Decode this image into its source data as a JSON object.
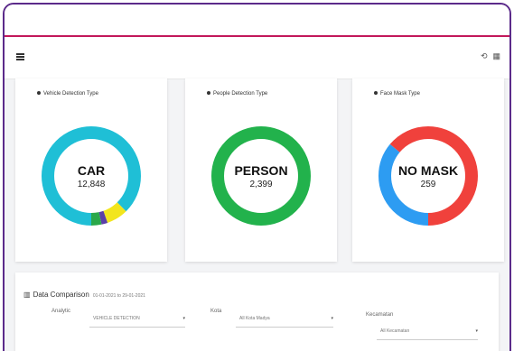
{
  "navbar": {
    "menu_icon": "hamburger-icon",
    "right_icons": [
      "refresh-icon",
      "calendar-icon"
    ]
  },
  "cards": [
    {
      "title": "Vehicle Detection Type",
      "center_label": "CAR",
      "center_value": "12,848",
      "segments": [
        {
          "label": "CAR",
          "fraction": 0.875,
          "color": "#1fbfd6"
        },
        {
          "label": "",
          "fraction": 0.07,
          "color": "#f2e51d"
        },
        {
          "label": "",
          "fraction": 0.02,
          "color": "#5b3fa8"
        },
        {
          "label": "",
          "fraction": 0.035,
          "color": "#2aa84a"
        }
      ]
    },
    {
      "title": "People Detection Type",
      "center_label": "PERSON",
      "center_value": "2,399",
      "segments": [
        {
          "label": "PERSON",
          "fraction": 1.0,
          "color": "#22b24c"
        }
      ]
    },
    {
      "title": "Face Mask Type",
      "center_label": "NO MASK",
      "center_value": "259",
      "segments": [
        {
          "label": "MASK",
          "fraction": 0.36,
          "color": "#2d9cf2"
        },
        {
          "label": "NO MASK",
          "fraction": 0.64,
          "color": "#f0413c"
        }
      ]
    }
  ],
  "comparison": {
    "icon": "bar-chart-icon",
    "title": "Data Comparison",
    "range": "01-01-2021 to 29-01-2021",
    "fields": [
      {
        "label": "Analytic",
        "value": "VEHICLE DETECTION"
      },
      {
        "label": "Kota",
        "value": "All Kota Madya"
      },
      {
        "label": "Kecamatan",
        "value": "All Kecamatan"
      }
    ]
  }
}
